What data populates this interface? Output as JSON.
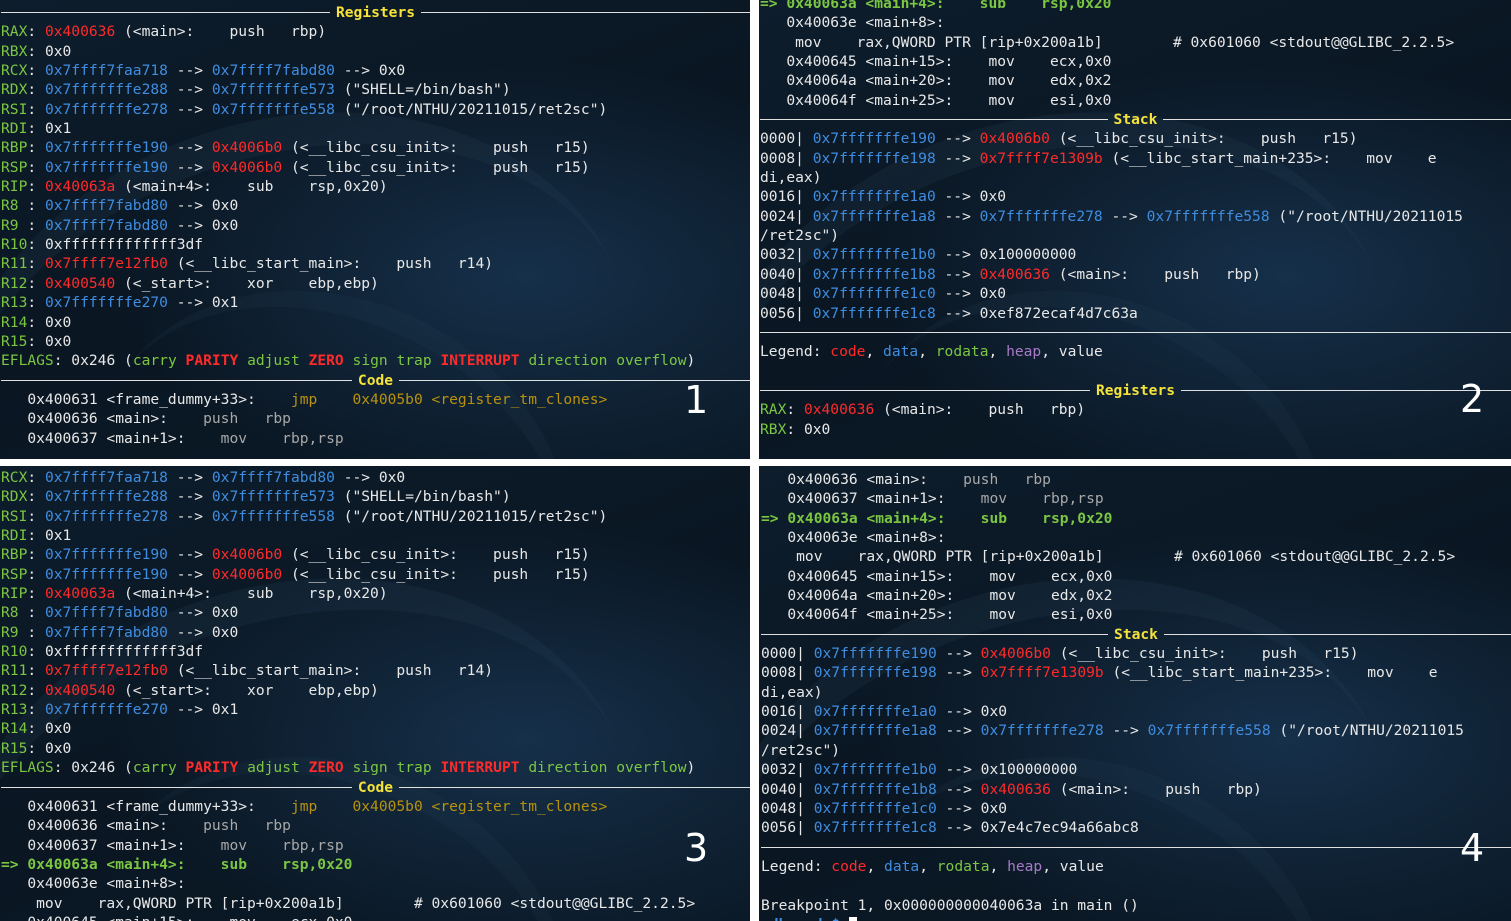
{
  "sections": {
    "registers": "Registers",
    "code": "Code",
    "stack": "Stack"
  },
  "panel_numbers": [
    "1",
    "2",
    "3",
    "4"
  ],
  "registers": [
    {
      "name": "RAX",
      "parts": [
        [
          "code",
          "0x400636"
        ],
        [
          "txt",
          " (<main>:\tpush   rbp)"
        ]
      ]
    },
    {
      "name": "RBX",
      "parts": [
        [
          "txt",
          "0x0"
        ]
      ]
    },
    {
      "name": "RCX",
      "parts": [
        [
          "data",
          "0x7ffff7faa718"
        ],
        [
          "txt",
          " --> "
        ],
        [
          "data",
          "0x7ffff7fabd80"
        ],
        [
          "txt",
          " --> 0x0"
        ]
      ]
    },
    {
      "name": "RDX",
      "parts": [
        [
          "data",
          "0x7fffffffe288"
        ],
        [
          "txt",
          " --> "
        ],
        [
          "data",
          "0x7fffffffe573"
        ],
        [
          "txt",
          " (\"SHELL=/bin/bash\")"
        ]
      ]
    },
    {
      "name": "RSI",
      "parts": [
        [
          "data",
          "0x7fffffffe278"
        ],
        [
          "txt",
          " --> "
        ],
        [
          "data",
          "0x7fffffffe558"
        ],
        [
          "txt",
          " (\"/root/NTHU/20211015/ret2sc\")"
        ]
      ]
    },
    {
      "name": "RDI",
      "parts": [
        [
          "txt",
          "0x1"
        ]
      ]
    },
    {
      "name": "RBP",
      "parts": [
        [
          "data",
          "0x7fffffffe190"
        ],
        [
          "txt",
          " --> "
        ],
        [
          "code",
          "0x4006b0"
        ],
        [
          "txt",
          " (<__libc_csu_init>:\tpush   r15)"
        ]
      ]
    },
    {
      "name": "RSP",
      "parts": [
        [
          "data",
          "0x7fffffffe190"
        ],
        [
          "txt",
          " --> "
        ],
        [
          "code",
          "0x4006b0"
        ],
        [
          "txt",
          " (<__libc_csu_init>:\tpush   r15)"
        ]
      ]
    },
    {
      "name": "RIP",
      "parts": [
        [
          "code",
          "0x40063a"
        ],
        [
          "txt",
          " (<main+4>:\tsub    rsp,0x20)"
        ]
      ]
    },
    {
      "name": "R8 ",
      "parts": [
        [
          "data",
          "0x7ffff7fabd80"
        ],
        [
          "txt",
          " --> 0x0"
        ]
      ]
    },
    {
      "name": "R9 ",
      "parts": [
        [
          "data",
          "0x7ffff7fabd80"
        ],
        [
          "txt",
          " --> 0x0"
        ]
      ]
    },
    {
      "name": "R10",
      "parts": [
        [
          "txt",
          "0xfffffffffffff3df"
        ]
      ]
    },
    {
      "name": "R11",
      "parts": [
        [
          "code",
          "0x7ffff7e12fb0"
        ],
        [
          "txt",
          " (<__libc_start_main>:\tpush   r14)"
        ]
      ]
    },
    {
      "name": "R12",
      "parts": [
        [
          "code",
          "0x400540"
        ],
        [
          "txt",
          " (<_start>:\txor    ebp,ebp)"
        ]
      ]
    },
    {
      "name": "R13",
      "parts": [
        [
          "data",
          "0x7fffffffe270"
        ],
        [
          "txt",
          " --> 0x1"
        ]
      ]
    },
    {
      "name": "R14",
      "parts": [
        [
          "txt",
          "0x0"
        ]
      ]
    },
    {
      "name": "R15",
      "parts": [
        [
          "txt",
          "0x0"
        ]
      ]
    }
  ],
  "eflags": {
    "label": "EFLAGS",
    "value": "0x246",
    "flags": [
      {
        "name": "carry",
        "on": false
      },
      {
        "name": "PARITY",
        "on": true
      },
      {
        "name": "adjust",
        "on": false
      },
      {
        "name": "ZERO",
        "on": true
      },
      {
        "name": "sign",
        "on": false
      },
      {
        "name": "trap",
        "on": false
      },
      {
        "name": "INTERRUPT",
        "on": true
      },
      {
        "name": "direction",
        "on": false
      },
      {
        "name": "overflow",
        "on": false
      }
    ]
  },
  "code_lines": [
    {
      "kind": "jmp",
      "addr": "   0x400631 <frame_dummy+33>:",
      "ins": "\tjmp    ",
      "arg": "0x4005b0 <register_tm_clones>"
    },
    {
      "kind": "dim",
      "addr": "   0x400636 <main>:",
      "ins": "\tpush   rbp"
    },
    {
      "kind": "dim",
      "addr": "   0x400637 <main+1>:",
      "ins": "\tmov    rbp,rsp"
    },
    {
      "kind": "cur",
      "addr": "=> 0x40063a <main+4>:",
      "ins": "\tsub    rsp,0x20"
    },
    {
      "kind": "txt",
      "addr": "   0x40063e <main+8>:",
      "ins": ""
    },
    {
      "kind": "txt",
      "addr": "    mov    rax,QWORD PTR [rip+0x200a1b]        # 0x601060 <stdout@@GLIBC_2.2.5>",
      "ins": ""
    },
    {
      "kind": "txt",
      "addr": "   0x400645 <main+15>:",
      "ins": "\tmov    ecx,0x0"
    },
    {
      "kind": "txt",
      "addr": "   0x40064a <main+20>:",
      "ins": "\tmov    edx,0x2"
    },
    {
      "kind": "txt",
      "addr": "   0x40064f <main+25>:",
      "ins": "\tmov    esi,0x0"
    }
  ],
  "stack_a": [
    [
      [
        "txt",
        "0000| "
      ],
      [
        "data",
        "0x7fffffffe190"
      ],
      [
        "txt",
        " --> "
      ],
      [
        "code",
        "0x4006b0"
      ],
      [
        "txt",
        " (<__libc_csu_init>:\tpush   r15)"
      ]
    ],
    [
      [
        "txt",
        "0008| "
      ],
      [
        "data",
        "0x7fffffffe198"
      ],
      [
        "txt",
        " --> "
      ],
      [
        "code",
        "0x7ffff7e1309b"
      ],
      [
        "txt",
        " (<__libc_start_main+235>:\tmov    e"
      ]
    ],
    [
      [
        "txt",
        "di,eax)"
      ]
    ],
    [
      [
        "txt",
        "0016| "
      ],
      [
        "data",
        "0x7fffffffe1a0"
      ],
      [
        "txt",
        " --> 0x0"
      ]
    ],
    [
      [
        "txt",
        "0024| "
      ],
      [
        "data",
        "0x7fffffffe1a8"
      ],
      [
        "txt",
        " --> "
      ],
      [
        "data",
        "0x7fffffffe278"
      ],
      [
        "txt",
        " --> "
      ],
      [
        "data",
        "0x7fffffffe558"
      ],
      [
        "txt",
        " (\"/root/NTHU/20211015"
      ]
    ],
    [
      [
        "txt",
        "/ret2sc\")"
      ]
    ],
    [
      [
        "txt",
        "0032| "
      ],
      [
        "data",
        "0x7fffffffe1b0"
      ],
      [
        "txt",
        " --> 0x100000000"
      ]
    ],
    [
      [
        "txt",
        "0040| "
      ],
      [
        "data",
        "0x7fffffffe1b8"
      ],
      [
        "txt",
        " --> "
      ],
      [
        "code",
        "0x400636"
      ],
      [
        "txt",
        " (<main>:\tpush   rbp)"
      ]
    ],
    [
      [
        "txt",
        "0048| "
      ],
      [
        "data",
        "0x7fffffffe1c0"
      ],
      [
        "txt",
        " --> 0x0"
      ]
    ],
    [
      [
        "txt",
        "0056| "
      ],
      [
        "data",
        "0x7fffffffe1c8"
      ],
      [
        "txt",
        " --> 0xef872ecaf4d7c63a"
      ]
    ]
  ],
  "stack_b_last": [
    [
      "txt",
      "0056| "
    ],
    [
      "data",
      "0x7fffffffe1c8"
    ],
    [
      "txt",
      " --> 0x7e4c7ec94a66abc8"
    ]
  ],
  "legend": {
    "label": "Legend: ",
    "items": [
      {
        "cls": "code",
        "text": "code"
      },
      {
        "cls": "data",
        "text": "data"
      },
      {
        "cls": "ro",
        "text": "rodata"
      },
      {
        "cls": "heap",
        "text": "heap"
      },
      {
        "cls": "txt",
        "text": "value"
      }
    ]
  },
  "breakpoint": "Breakpoint 1, 0x000000000040063a in main ()",
  "prompt": "gdb-peda$ ",
  "colors": {
    "background": "#0b1a28",
    "code": "#ff2a2a",
    "data": "#3f8de0",
    "rodata": "#7bc642",
    "heap": "#a77ac8",
    "section_title": "#f5e33a"
  }
}
